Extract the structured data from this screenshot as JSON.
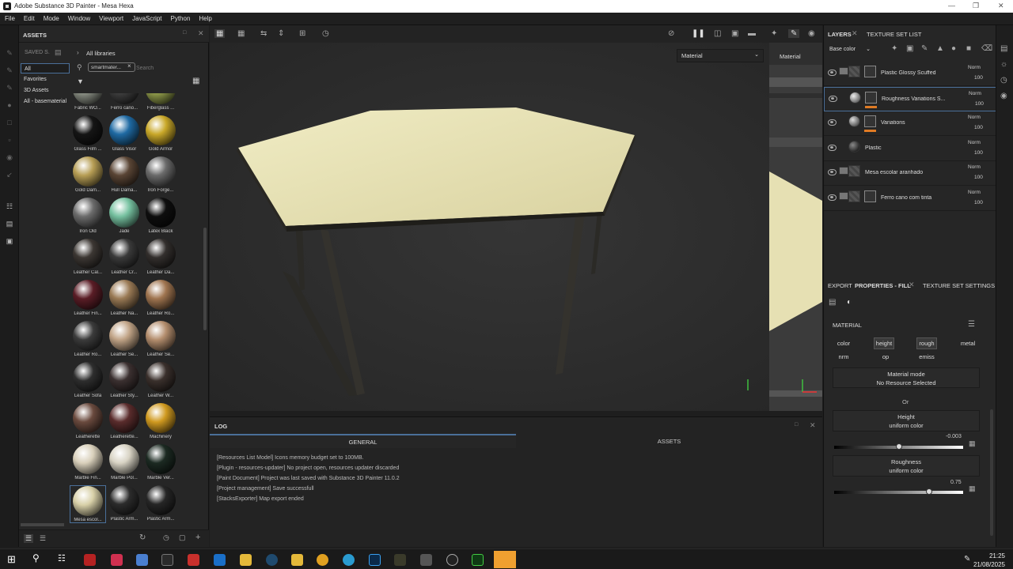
{
  "window": {
    "title": "Adobe Substance 3D Painter - Mesa Hexa"
  },
  "menu": [
    "File",
    "Edit",
    "Mode",
    "Window",
    "Viewport",
    "JavaScript",
    "Python",
    "Help"
  ],
  "assets": {
    "tab_title": "ASSETS",
    "saved_label": "SAVED S.",
    "libraries": [
      "All",
      "Favorites",
      "3D Assets",
      "All - basematerial"
    ],
    "all_libraries": "All libraries",
    "filter_tag": "smartmater...",
    "search_placeholder": "Search",
    "materials": [
      {
        "label": "Fabric WO...",
        "color": "#8a8f84"
      },
      {
        "label": "Ferro cano...",
        "color": "#3d3d3d"
      },
      {
        "label": "Fiberglass ...",
        "color": "#8f9a4a"
      },
      {
        "label": "Glass Film ...",
        "color": "#151515"
      },
      {
        "label": "Glass Visor",
        "color": "#1f6aa3"
      },
      {
        "label": "Gold Armor",
        "color": "#c9a829"
      },
      {
        "label": "Gold Dam...",
        "color": "#b79e55"
      },
      {
        "label": "Hull Dama...",
        "color": "#5a4535"
      },
      {
        "label": "Iron Forge...",
        "color": "#6a6a6a"
      },
      {
        "label": "Iron Old",
        "color": "#6c6c6c"
      },
      {
        "label": "Jade",
        "color": "#76c1a0"
      },
      {
        "label": "Latex Black",
        "color": "#0e0e0e"
      },
      {
        "label": "Leather Cal...",
        "color": "#3c3733"
      },
      {
        "label": "Leather Cr...",
        "color": "#3a3a3a"
      },
      {
        "label": "Leather Da...",
        "color": "#332f2d"
      },
      {
        "label": "Leather Fin...",
        "color": "#5a1d26"
      },
      {
        "label": "Leather Na...",
        "color": "#9a7a55"
      },
      {
        "label": "Leather Ro...",
        "color": "#a07550"
      },
      {
        "label": "Leather Ro...",
        "color": "#3b3b3b"
      },
      {
        "label": "Leather Se...",
        "color": "#c0a386"
      },
      {
        "label": "Leather Se...",
        "color": "#b48e6e"
      },
      {
        "label": "Leather Sofa",
        "color": "#2e2e2e"
      },
      {
        "label": "Leather Sty...",
        "color": "#3b3030"
      },
      {
        "label": "Leather W...",
        "color": "#3a302c"
      },
      {
        "label": "Leatherette",
        "color": "#6a4a3e"
      },
      {
        "label": "Leatherette...",
        "color": "#5a2c2c"
      },
      {
        "label": "Machinery",
        "color": "#d09a20"
      },
      {
        "label": "Marble Fin...",
        "color": "#d9d0bb"
      },
      {
        "label": "Marble Pol...",
        "color": "#d8d3c4"
      },
      {
        "label": "Marble Ver...",
        "color": "#1c2a22"
      },
      {
        "label": "Mesa escol...",
        "color": "#d8d0a8"
      },
      {
        "label": "Plastic Arm...",
        "color": "#2c2c2c"
      },
      {
        "label": "Plastic Arm...",
        "color": "#262626"
      }
    ]
  },
  "viewport": {
    "material_dropdown": "Material",
    "uv_label": "Material"
  },
  "log": {
    "title": "LOG",
    "tabs": [
      "GENERAL",
      "ASSETS"
    ],
    "lines": [
      "[Resources List Model] Icons memory budget set to 100MB.",
      "[Plugin - resources-updater] No project open, resources updater discarded",
      "[Paint Document] Project was last saved with Substance 3D Painter 11.0.2",
      "[Project management] Save successfull",
      "[StacksExporter] Map export ended"
    ]
  },
  "layers": {
    "tabs": [
      "LAYERS",
      "TEXTURE SET LIST"
    ],
    "channel": "Base color",
    "items": [
      {
        "name": "Plastic Glossy Scuffed",
        "blend": "Norm",
        "opacity": "100",
        "folder": true
      },
      {
        "name": "Roughness Variations S...",
        "blend": "Norm",
        "opacity": "100",
        "folder": false
      },
      {
        "name": "Variations",
        "blend": "Norm",
        "opacity": "100",
        "folder": false
      },
      {
        "name": "Plastic",
        "blend": "Norm",
        "opacity": "100",
        "folder": false
      },
      {
        "name": "Mesa escolar aranhado",
        "blend": "Norm",
        "opacity": "100",
        "folder": true
      },
      {
        "name": "Ferro cano com tinta",
        "blend": "Norm",
        "opacity": "100",
        "folder": true
      }
    ]
  },
  "properties": {
    "tabs": [
      "EXPORT",
      "PROPERTIES - FILL",
      "TEXTURE SET SETTINGS"
    ],
    "section": "MATERIAL",
    "channels_row1": [
      "color",
      "height",
      "rough",
      "metal"
    ],
    "channels_row2": [
      "nrm",
      "op",
      "emiss"
    ],
    "material_mode": "Material mode",
    "no_resource": "No Resource Selected",
    "or": "Or",
    "height_label": "Height",
    "height_mode": "uniform color",
    "height_value": "-0.003",
    "height_fraction": 0.5,
    "roughness_label": "Roughness",
    "roughness_mode": "uniform color",
    "roughness_value": "0.75",
    "roughness_fraction": 0.75
  },
  "taskbar": {
    "time": "21:25",
    "date": "21/08/2025"
  }
}
